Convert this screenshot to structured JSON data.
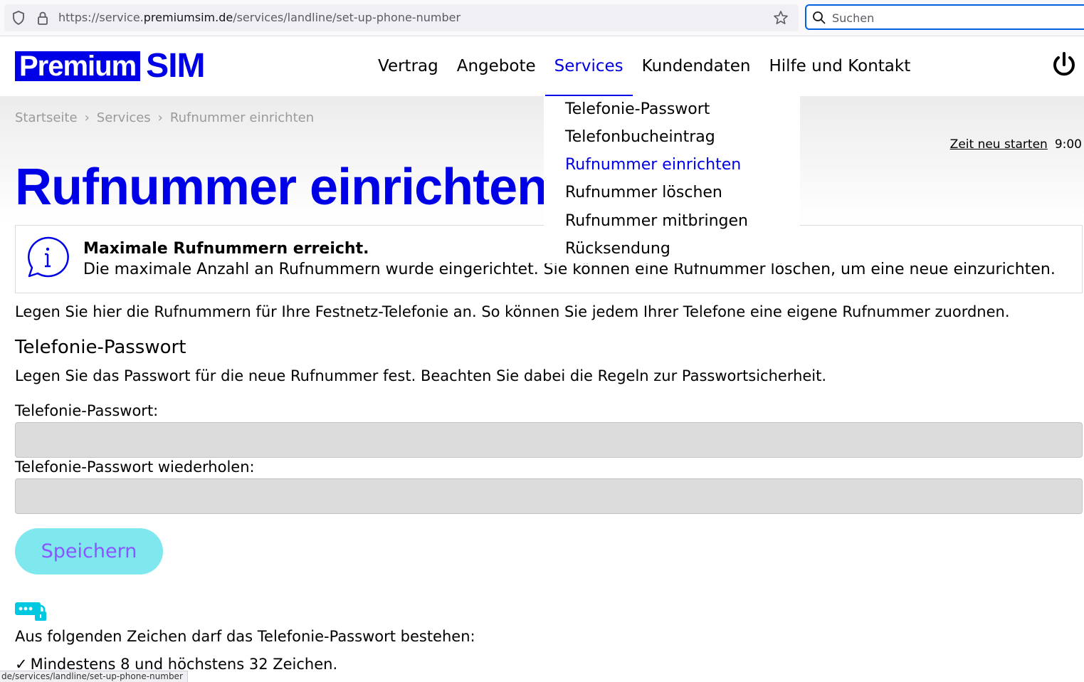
{
  "browser": {
    "url_prefix": "https://service.",
    "url_domain": "premiumsim.de",
    "url_path": "/services/landline/set-up-phone-number",
    "search_placeholder": "Suchen",
    "status_url": "de/services/landline/set-up-phone-number"
  },
  "header": {
    "logo_left": "Premium",
    "logo_right": "SIM",
    "nav": [
      "Vertrag",
      "Angebote",
      "Services",
      "Kundendaten",
      "Hilfe und Kontakt"
    ],
    "active_nav": "Services"
  },
  "dropdown": {
    "items": [
      "Telefonie-Passwort",
      "Telefonbucheintrag",
      "Rufnummer einrichten",
      "Rufnummer löschen",
      "Rufnummer mitbringen",
      "Rücksendung"
    ],
    "active_item": "Rufnummer einrichten"
  },
  "breadcrumb": [
    "Startseite",
    "Services",
    "Rufnummer einrichten"
  ],
  "timer": {
    "restart_label": "Zeit neu starten",
    "time": "9:00"
  },
  "page": {
    "title": "Rufnummer einrichten",
    "info_title": "Maximale Rufnummern erreicht.",
    "info_text": "Die maximale Anzahl an Rufnummern wurde eingerichtet. Sie können eine Rufnummer löschen, um eine neue einzurichten.",
    "intro": "Legen Sie hier die Rufnummern für Ihre Festnetz-Telefonie an. So können Sie jedem Ihrer Telefone eine eigene Rufnummer zuordnen.",
    "section_heading": "Telefonie-Passwort",
    "section_text": "Legen Sie das Passwort für die neue Rufnummer fest. Beachten Sie dabei die Regeln zur Passwortsicherheit.",
    "password_label": "Telefonie-Passwort:",
    "password_repeat_label": "Telefonie-Passwort wiederholen:",
    "save_label": "Speichern",
    "rules_heading": "Aus folgenden Zeichen darf das Telefonie-Passwort bestehen:",
    "rule_1": "Mindestens 8 und höchstens 32 Zeichen."
  },
  "colors": {
    "brand": "#0000e6",
    "button_bg": "#7fe8ee",
    "button_text": "#8a56ff",
    "input_bg": "#dcdcdc"
  }
}
